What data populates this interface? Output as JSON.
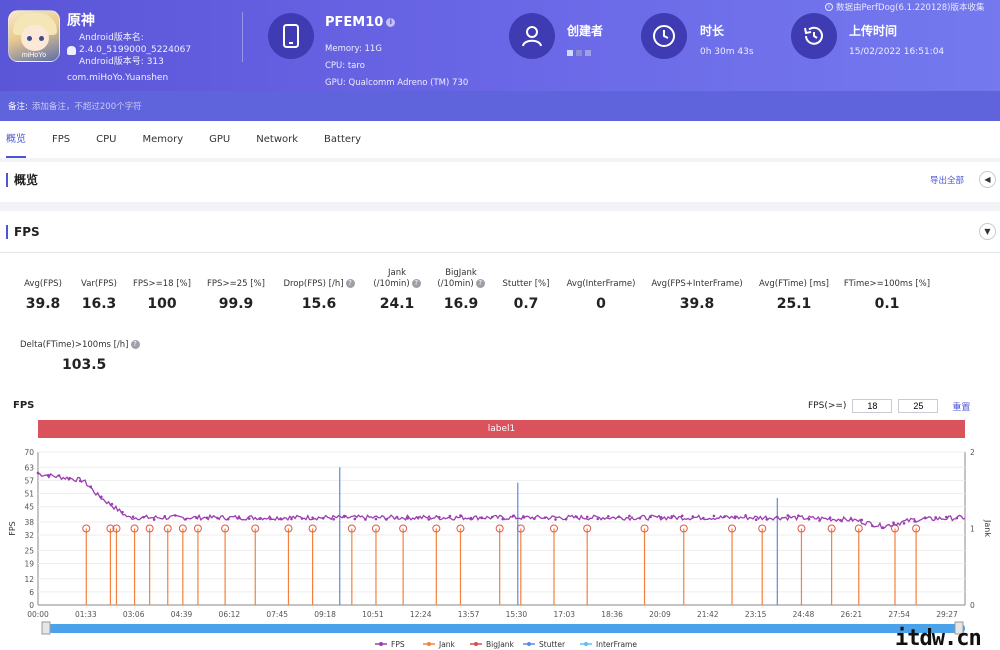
{
  "header": {
    "app_name": "原神",
    "android_version_label": "Android版本名:",
    "android_version": "2.4.0_5199000_5224067",
    "android_build": "Android版本号: 313",
    "package": "com.miHoYo.Yuanshen",
    "app_icon_brand": "miHoYo",
    "device_name": "PFEM10",
    "memory": "Memory: 11G",
    "cpu": "CPU: taro",
    "gpu": "GPU: Qualcomm Adreno (TM) 730",
    "creator_title": "创建者",
    "duration_title": "时长",
    "duration_value": "0h 30m 43s",
    "upload_title": "上传时间",
    "upload_value": "15/02/2022 16:51:04",
    "source_note": "数据由PerfDog(6.1.220128)版本收集"
  },
  "notes": {
    "label": "备注:",
    "placeholder": "添加备注，不超过200个字符"
  },
  "tabs": [
    "概览",
    "FPS",
    "CPU",
    "Memory",
    "GPU",
    "Network",
    "Battery"
  ],
  "overview": {
    "title": "概览",
    "export": "导出全部"
  },
  "fps_section": {
    "title": "FPS"
  },
  "metrics": [
    {
      "label": "Avg(FPS)",
      "value": "39.8"
    },
    {
      "label": "Var(FPS)",
      "value": "16.3"
    },
    {
      "label": "FPS>=18 [%]",
      "value": "100"
    },
    {
      "label": "FPS>=25 [%]",
      "value": "99.9"
    },
    {
      "label": "Drop(FPS) [/h]",
      "value": "15.6"
    },
    {
      "label": "Jank",
      "label2": "(/10min)",
      "value": "24.1"
    },
    {
      "label": "BigJank",
      "label2": "(/10min)",
      "value": "16.9"
    },
    {
      "label": "Stutter [%]",
      "value": "0.7"
    },
    {
      "label": "Avg(InterFrame)",
      "value": "0"
    },
    {
      "label": "Avg(FPS+InterFrame)",
      "value": "39.8"
    },
    {
      "label": "Avg(FTime) [ms]",
      "value": "25.1"
    },
    {
      "label": "FTime>=100ms [%]",
      "value": "0.1"
    },
    {
      "label": "Delta(FTime)>100ms [/h]",
      "value": "103.5"
    }
  ],
  "chart": {
    "title": "FPS",
    "threshold_label": "FPS(>=)",
    "threshold_1": "18",
    "threshold_2": "25",
    "reset": "重置",
    "label_bar": "label1"
  },
  "chart_data": {
    "type": "line",
    "title": "FPS",
    "ylabel": "FPS",
    "y2label": "Jank",
    "ylim": [
      0,
      70
    ],
    "y2lim": [
      0,
      2
    ],
    "yticks": [
      0,
      6,
      12,
      19,
      25,
      32,
      38,
      45,
      51,
      57,
      63,
      70
    ],
    "y2ticks": [
      0,
      1,
      2
    ],
    "xticks": [
      "00:00",
      "01:33",
      "03:06",
      "04:39",
      "06:12",
      "07:45",
      "09:18",
      "10:51",
      "12:24",
      "13:57",
      "15:30",
      "17:03",
      "18:36",
      "20:09",
      "21:42",
      "23:15",
      "24:48",
      "26:21",
      "27:54",
      "29:27"
    ],
    "legend": [
      "FPS",
      "Jank",
      "BigJank",
      "Stutter",
      "InterFrame"
    ],
    "legend_position": "bottom",
    "series": [
      {
        "name": "FPS",
        "color": "#9b3fb0",
        "x_min": [
          0,
          1.5,
          2,
          2.5,
          3,
          5,
          10,
          15,
          20,
          25,
          27,
          28,
          29,
          30.7
        ],
        "values": [
          60,
          57,
          50,
          45,
          40,
          40,
          40,
          40,
          40,
          40,
          39,
          36,
          39,
          40
        ]
      },
      {
        "name": "Jank",
        "color": "#f5813a",
        "x_min": [
          1.6,
          2.4,
          2.6,
          3.2,
          3.7,
          4.3,
          4.8,
          5.3,
          6.2,
          7.2,
          8.3,
          9.1,
          10.4,
          11.2,
          12.1,
          13.2,
          14.0,
          15.3,
          16.0,
          17.1,
          18.2,
          20.1,
          21.4,
          23.0,
          24.0,
          25.3,
          26.3,
          27.2,
          28.4,
          29.1
        ],
        "values": [
          1,
          1,
          1,
          1,
          1,
          1,
          1,
          1,
          1,
          1,
          1,
          1,
          1,
          1,
          1,
          1,
          1,
          1,
          1,
          1,
          1,
          1,
          1,
          1,
          1,
          1,
          1,
          1,
          1,
          1
        ]
      },
      {
        "name": "BigJank",
        "color": "#d94c52",
        "x_min": [],
        "values": []
      },
      {
        "name": "Stutter",
        "color": "#5b8ae0",
        "x_min": [
          10.0,
          15.9,
          24.5
        ],
        "values": [
          1.8,
          1.6,
          1.4
        ]
      },
      {
        "name": "InterFrame",
        "color": "#5ec1ea",
        "x_min": [],
        "values": []
      }
    ]
  },
  "watermark": "itdw.cn"
}
